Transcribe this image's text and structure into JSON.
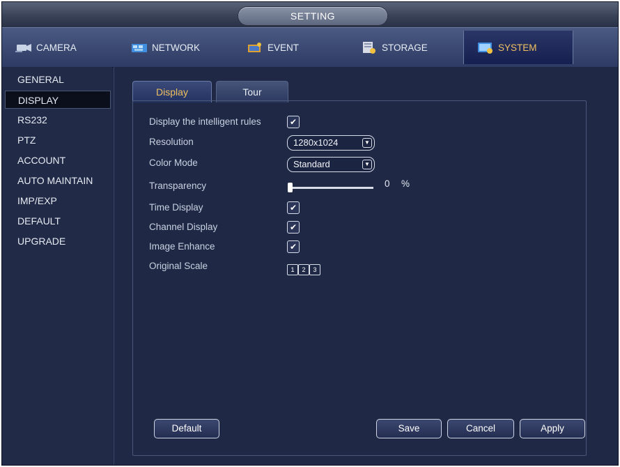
{
  "window": {
    "title": "SETTING"
  },
  "main_tabs": [
    {
      "label": "CAMERA",
      "icon": "camera-icon"
    },
    {
      "label": "NETWORK",
      "icon": "network-icon"
    },
    {
      "label": "EVENT",
      "icon": "event-icon"
    },
    {
      "label": "STORAGE",
      "icon": "storage-icon"
    },
    {
      "label": "SYSTEM",
      "icon": "system-icon",
      "active": true
    }
  ],
  "sidebar": {
    "items": [
      {
        "label": "GENERAL"
      },
      {
        "label": "DISPLAY",
        "active": true
      },
      {
        "label": "RS232"
      },
      {
        "label": "PTZ"
      },
      {
        "label": "ACCOUNT"
      },
      {
        "label": "AUTO MAINTAIN"
      },
      {
        "label": "IMP/EXP"
      },
      {
        "label": "DEFAULT"
      },
      {
        "label": "UPGRADE"
      }
    ]
  },
  "sub_tabs": [
    {
      "label": "Display",
      "active": true
    },
    {
      "label": "Tour"
    }
  ],
  "form": {
    "intelligent_rules": {
      "label": "Display the intelligent rules",
      "checked": true
    },
    "resolution": {
      "label": "Resolution",
      "value": "1280x1024"
    },
    "color_mode": {
      "label": "Color Mode",
      "value": "Standard"
    },
    "transparency": {
      "label": "Transparency",
      "value": "0",
      "unit": "%"
    },
    "time_display": {
      "label": "Time Display",
      "checked": true
    },
    "channel_display": {
      "label": "Channel Display",
      "checked": true
    },
    "image_enhance": {
      "label": "Image Enhance",
      "checked": true
    },
    "original_scale": {
      "label": "Original Scale",
      "buttons": [
        "1",
        "2",
        "3"
      ]
    }
  },
  "buttons": {
    "default": "Default",
    "save": "Save",
    "cancel": "Cancel",
    "apply": "Apply"
  },
  "colors": {
    "background": "#1e2846",
    "active_tab_text": "#f0c060",
    "panel_border": "#4c587a"
  }
}
